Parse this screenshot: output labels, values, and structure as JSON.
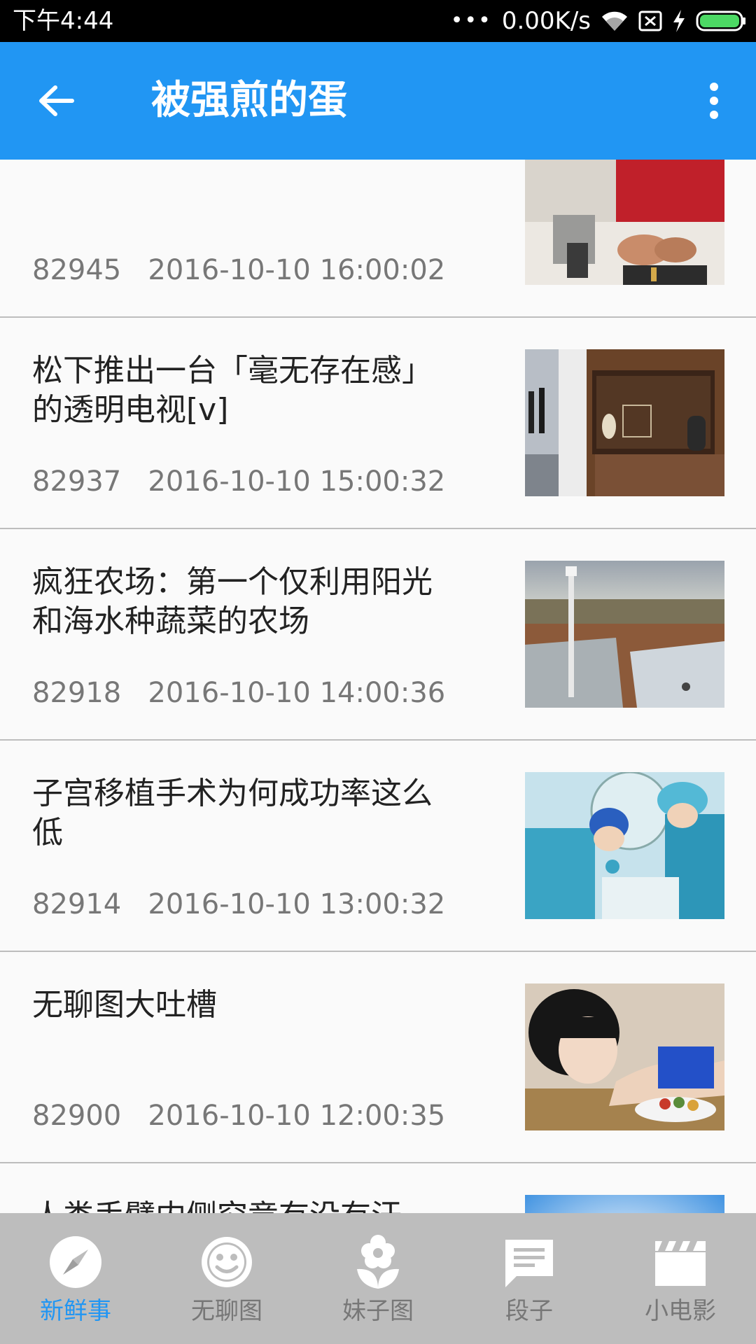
{
  "status_bar": {
    "time": "下午4:44",
    "dots": "•••",
    "network_speed": "0.00K/s",
    "icons": [
      "wifi-icon",
      "no-sim-icon",
      "charging-icon",
      "battery-icon"
    ]
  },
  "app_bar": {
    "title": "被强煎的蛋",
    "back_icon": "arrow-back-icon",
    "menu_icon": "more-vert-icon",
    "color": "#2196f3"
  },
  "posts": [
    {
      "title": "",
      "id": "82945",
      "datetime": "2016-10-10 16:00:02",
      "thumb": "sewing-machine-photo"
    },
    {
      "title": "松下推出一台「毫无存在感」的透明电视[v]",
      "id": "82937",
      "datetime": "2016-10-10 15:00:32",
      "thumb": "transparent-tv-photo"
    },
    {
      "title": "疯狂农场：第一个仅利用阳光和海水种蔬菜的农场",
      "id": "82918",
      "datetime": "2016-10-10 14:00:36",
      "thumb": "solar-farm-photo"
    },
    {
      "title": "子宫移植手术为何成功率这么低",
      "id": "82914",
      "datetime": "2016-10-10 13:00:32",
      "thumb": "surgery-photo"
    },
    {
      "title": "无聊图大吐槽",
      "id": "82900",
      "datetime": "2016-10-10 12:00:35",
      "thumb": "girl-photo"
    },
    {
      "title": "人类手臂内侧究竟有没有汗毛？",
      "id": "",
      "datetime": "",
      "thumb": "raised-fists-photo"
    }
  ],
  "bottom_nav": {
    "items": [
      {
        "label": "新鲜事",
        "icon": "compass-icon",
        "active": true
      },
      {
        "label": "无聊图",
        "icon": "smiley-icon",
        "active": false
      },
      {
        "label": "妹子图",
        "icon": "flower-icon",
        "active": false
      },
      {
        "label": "段子",
        "icon": "chat-icon",
        "active": false
      },
      {
        "label": "小电影",
        "icon": "clapperboard-icon",
        "active": false
      }
    ],
    "active_color": "#2196f3",
    "inactive_color": "#777777"
  }
}
